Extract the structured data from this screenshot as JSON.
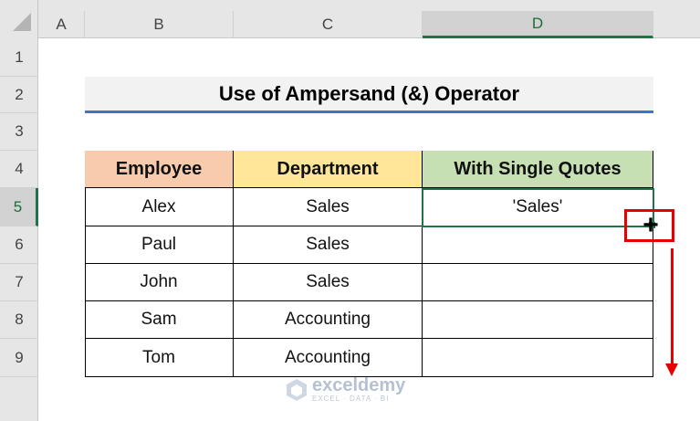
{
  "columns": [
    "A",
    "B",
    "C",
    "D"
  ],
  "rows": [
    "1",
    "2",
    "3",
    "4",
    "5",
    "6",
    "7",
    "8",
    "9"
  ],
  "title": "Use of Ampersand (&) Operator",
  "table": {
    "headers": [
      "Employee",
      "Department",
      "With Single Quotes"
    ],
    "rows": [
      [
        "Alex",
        "Sales",
        "'Sales'"
      ],
      [
        "Paul",
        "Sales",
        ""
      ],
      [
        "John",
        "Sales",
        ""
      ],
      [
        "Sam",
        "Accounting",
        ""
      ],
      [
        "Tom",
        "Accounting",
        ""
      ]
    ]
  },
  "active_cell": "D5",
  "colors": {
    "accent_green": "#217346",
    "annotation_red": "#e60000",
    "title_underline": "#4472c4"
  },
  "icons": {
    "fill_handle_cursor": "plus-cursor-icon",
    "drag_arrow": "arrow-down-icon",
    "logo": "exceldemy-logo-icon"
  },
  "watermark": {
    "name": "exceldemy",
    "tagline": "EXCEL · DATA · BI"
  }
}
